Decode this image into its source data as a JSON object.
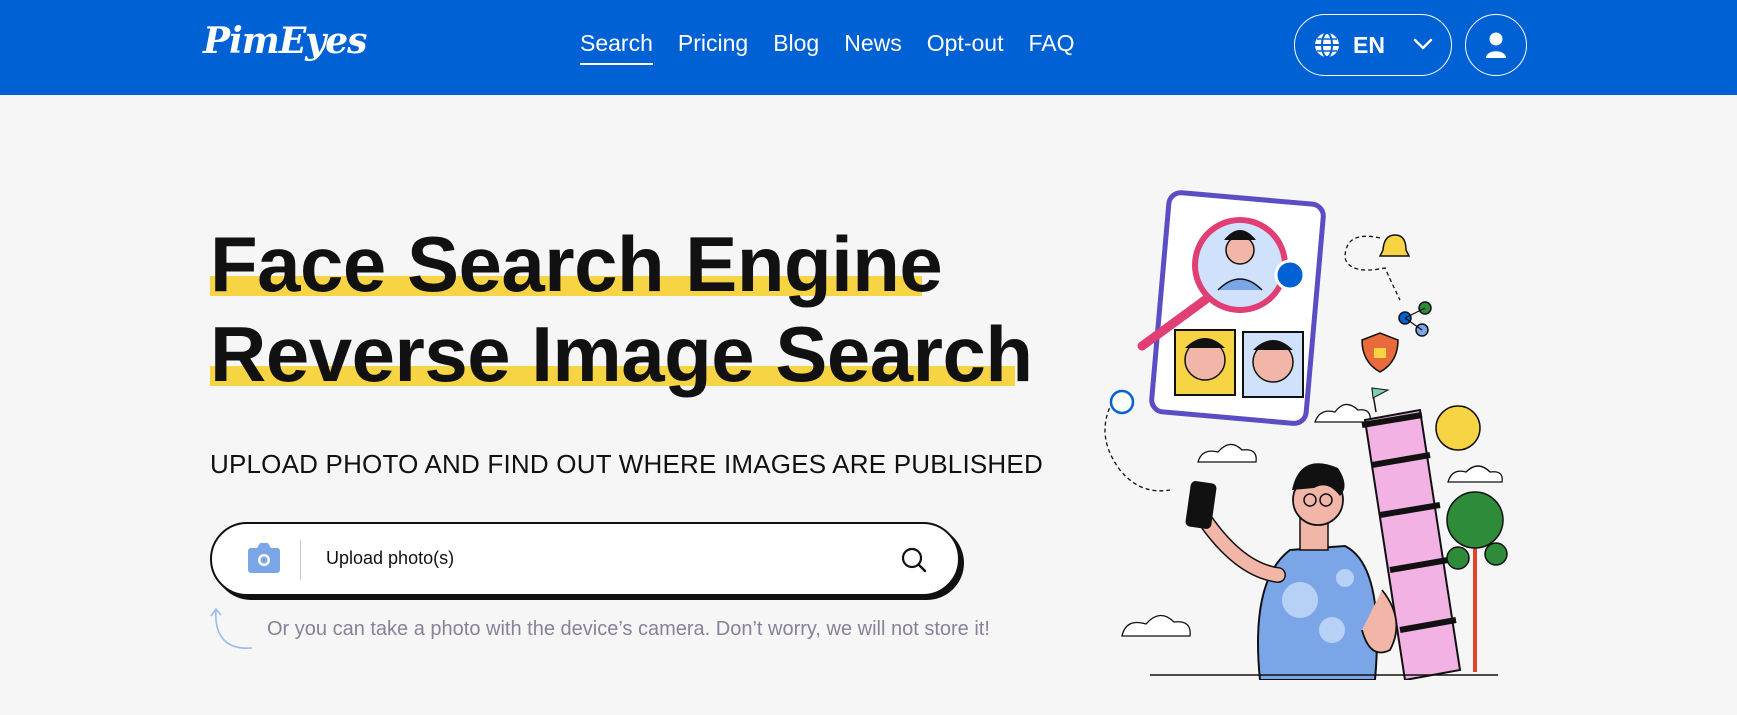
{
  "header": {
    "logo": "PimEyes",
    "nav": [
      {
        "label": "Search",
        "active": true
      },
      {
        "label": "Pricing",
        "active": false
      },
      {
        "label": "Blog",
        "active": false
      },
      {
        "label": "News",
        "active": false
      },
      {
        "label": "Opt-out",
        "active": false
      },
      {
        "label": "FAQ",
        "active": false
      }
    ],
    "language": "EN",
    "icons": {
      "language": "globe-icon",
      "dropdown": "chevron-down-icon",
      "account": "user-icon"
    }
  },
  "hero": {
    "title_line1": "Face Search Engine",
    "title_line2": "Reverse Image Search",
    "subtitle": "UPLOAD PHOTO AND FIND OUT WHERE IMAGES ARE PUBLISHED",
    "upload_label": "Upload photo(s)",
    "note": "Or you can take a photo with the device’s camera. Don’t worry, we will not store it!"
  },
  "colors": {
    "header": "#0061d5",
    "highlight": "#f7d444",
    "background": "#f6f6f6",
    "camera_icon": "#7aa6e8",
    "note_text": "#8a8098"
  }
}
